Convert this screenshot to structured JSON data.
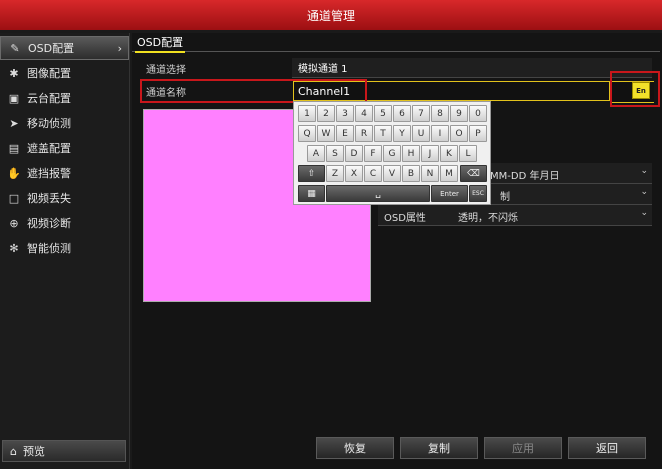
{
  "window": {
    "title": "通道管理"
  },
  "sidebar": {
    "items": [
      {
        "label": "OSD配置",
        "icon": "osd-icon",
        "active": true
      },
      {
        "label": "图像配置",
        "icon": "image-icon"
      },
      {
        "label": "云台配置",
        "icon": "ptz-icon"
      },
      {
        "label": "移动侦测",
        "icon": "motion-icon"
      },
      {
        "label": "遮盖配置",
        "icon": "mask-icon"
      },
      {
        "label": "遮挡报警",
        "icon": "tamper-icon"
      },
      {
        "label": "视频丢失",
        "icon": "video-loss-icon"
      },
      {
        "label": "视频诊断",
        "icon": "diagnosis-icon"
      },
      {
        "label": "智能侦测",
        "icon": "smart-icon"
      }
    ],
    "bottom": {
      "label": "预览",
      "icon": "home-icon"
    }
  },
  "tab": {
    "label": "OSD配置"
  },
  "form": {
    "channel_select": {
      "label": "通道选择",
      "value": "模拟通道 1"
    },
    "channel_name": {
      "label": "通道名称",
      "value": "Channel1",
      "lang_button": "En"
    },
    "date_format": {
      "value": "MM-DD 年月日"
    },
    "time_format": {
      "value": "制"
    },
    "osd_attr": {
      "label": "OSD属性",
      "value": "透明，不闪烁"
    }
  },
  "keyboard": {
    "row1": [
      "1",
      "2",
      "3",
      "4",
      "5",
      "6",
      "7",
      "8",
      "9",
      "0"
    ],
    "row2": [
      "Q",
      "W",
      "E",
      "R",
      "T",
      "Y",
      "U",
      "I",
      "O",
      "P"
    ],
    "row3": [
      "A",
      "S",
      "D",
      "F",
      "G",
      "H",
      "J",
      "K",
      "L"
    ],
    "row4": [
      "Z",
      "X",
      "C",
      "V",
      "B",
      "N",
      "M"
    ],
    "enter": "Enter",
    "esc": "ESC"
  },
  "footer": {
    "restore": "恢复",
    "copy": "复制",
    "apply": "应用",
    "back": "返回"
  },
  "colors": {
    "title_red": "#c8171b",
    "preview_pink": "#ff80ff",
    "accent_yellow": "#f3e12a"
  }
}
